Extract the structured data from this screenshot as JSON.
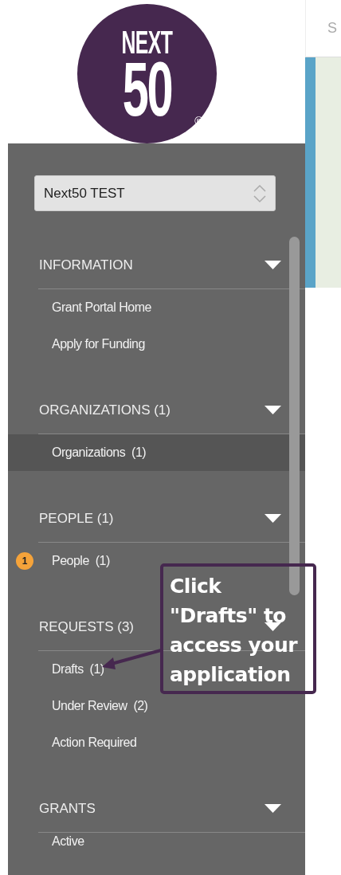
{
  "logo": {
    "line_1": "NEXT",
    "line_2": "50",
    "mark": "®"
  },
  "top_bar": {
    "text": "S"
  },
  "org_select": {
    "value": "Next50 TEST"
  },
  "sections": [
    {
      "title": "INFORMATION",
      "items": [
        {
          "label": "Grant Portal Home",
          "selected": false
        },
        {
          "label": "Apply for Funding",
          "selected": false
        }
      ]
    },
    {
      "title": "ORGANIZATIONS (1)",
      "items": [
        {
          "label": "Organizations  (1)",
          "selected": true
        }
      ]
    },
    {
      "title": "PEOPLE (1)",
      "items": [
        {
          "label": "People  (1)",
          "selected": false,
          "badge": "1"
        }
      ]
    },
    {
      "title": "REQUESTS (3)",
      "items": [
        {
          "label": "Drafts  (1)",
          "selected": false
        },
        {
          "label": "Under Review  (2)",
          "selected": false
        },
        {
          "label": "Action Required",
          "selected": false
        }
      ]
    },
    {
      "title": "GRANTS",
      "items": [
        {
          "label": "Active",
          "selected": false
        }
      ]
    }
  ],
  "callout": {
    "lines": [
      "Click",
      "\"Drafts\" to",
      "access your",
      "application"
    ]
  }
}
